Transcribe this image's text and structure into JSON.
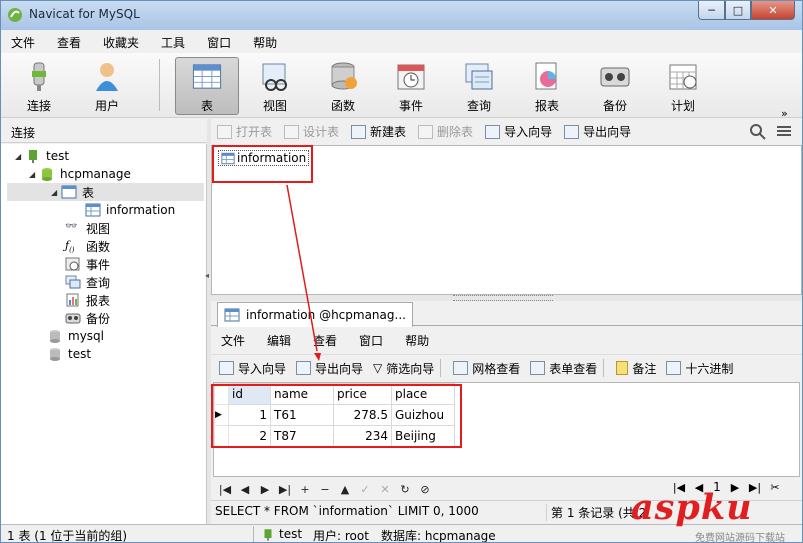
{
  "window": {
    "title": "Navicat for MySQL",
    "min": "─",
    "max": "□",
    "close": "✕"
  },
  "menu": [
    "文件",
    "查看",
    "收藏夹",
    "工具",
    "窗口",
    "帮助"
  ],
  "toolbar": {
    "items": [
      {
        "label": "连接",
        "icon": "connection-plug-icon"
      },
      {
        "label": "用户",
        "icon": "user-icon"
      },
      {
        "label": "表",
        "icon": "table-icon",
        "active": true
      },
      {
        "label": "视图",
        "icon": "view-icon"
      },
      {
        "label": "函数",
        "icon": "function-icon"
      },
      {
        "label": "事件",
        "icon": "event-clock-icon"
      },
      {
        "label": "查询",
        "icon": "query-icon"
      },
      {
        "label": "报表",
        "icon": "report-icon"
      },
      {
        "label": "备份",
        "icon": "backup-tape-icon"
      },
      {
        "label": "计划",
        "icon": "schedule-calendar-icon"
      }
    ],
    "more": "»"
  },
  "connection_header": "连接",
  "object_toolbar": {
    "open": "打开表",
    "design": "设计表",
    "new": "新建表",
    "delete": "删除表",
    "import": "导入向导",
    "export": "导出向导"
  },
  "tree": {
    "root": "test",
    "db": "hcpmanage",
    "tables_node": "表",
    "table": "information",
    "views": "视图",
    "functions": "函数",
    "events": "事件",
    "queries": "查询",
    "reports": "报表",
    "backups": "备份",
    "db2": "mysql",
    "db3": "test"
  },
  "object_list": {
    "item": "information"
  },
  "tab": {
    "title": "information @hcpmanag..."
  },
  "sub_menu": [
    "文件",
    "编辑",
    "查看",
    "窗口",
    "帮助"
  ],
  "sub_toolbar": {
    "import": "导入向导",
    "export": "导出向导",
    "filter": "筛选向导",
    "grid_view": "网格查看",
    "form_view": "表单查看",
    "memo": "备注",
    "hex": "十六进制"
  },
  "grid": {
    "columns": [
      "id",
      "name",
      "price",
      "place"
    ],
    "rows": [
      {
        "id": "1",
        "name": "T61",
        "price": "278.5",
        "place": "Guizhou"
      },
      {
        "id": "2",
        "name": "T87",
        "price": "234",
        "place": "Beijing"
      }
    ]
  },
  "nav": [
    "|◀",
    "◀",
    "▶",
    "▶|",
    "+",
    "−",
    "▲",
    "✓",
    "✕",
    "↻",
    "⊘"
  ],
  "pager": {
    "first": "|◀",
    "prev": "◀",
    "page": "1",
    "next": "▶",
    "last": "▶|"
  },
  "sql_status": "SELECT * FROM `information` LIMIT 0, 1000",
  "record_status": "第 1 条记录 (共 2",
  "status": {
    "selection": "1 表 (1 位于当前的组)",
    "connection": "test",
    "user": "用户: root",
    "database": "数据库: hcpmanage"
  },
  "watermark": {
    "text": "aspku",
    "sub": "免费网站源码下载站"
  },
  "colors": {
    "annotation": "#e31b1b",
    "title_bar": "#b9d1ee"
  }
}
